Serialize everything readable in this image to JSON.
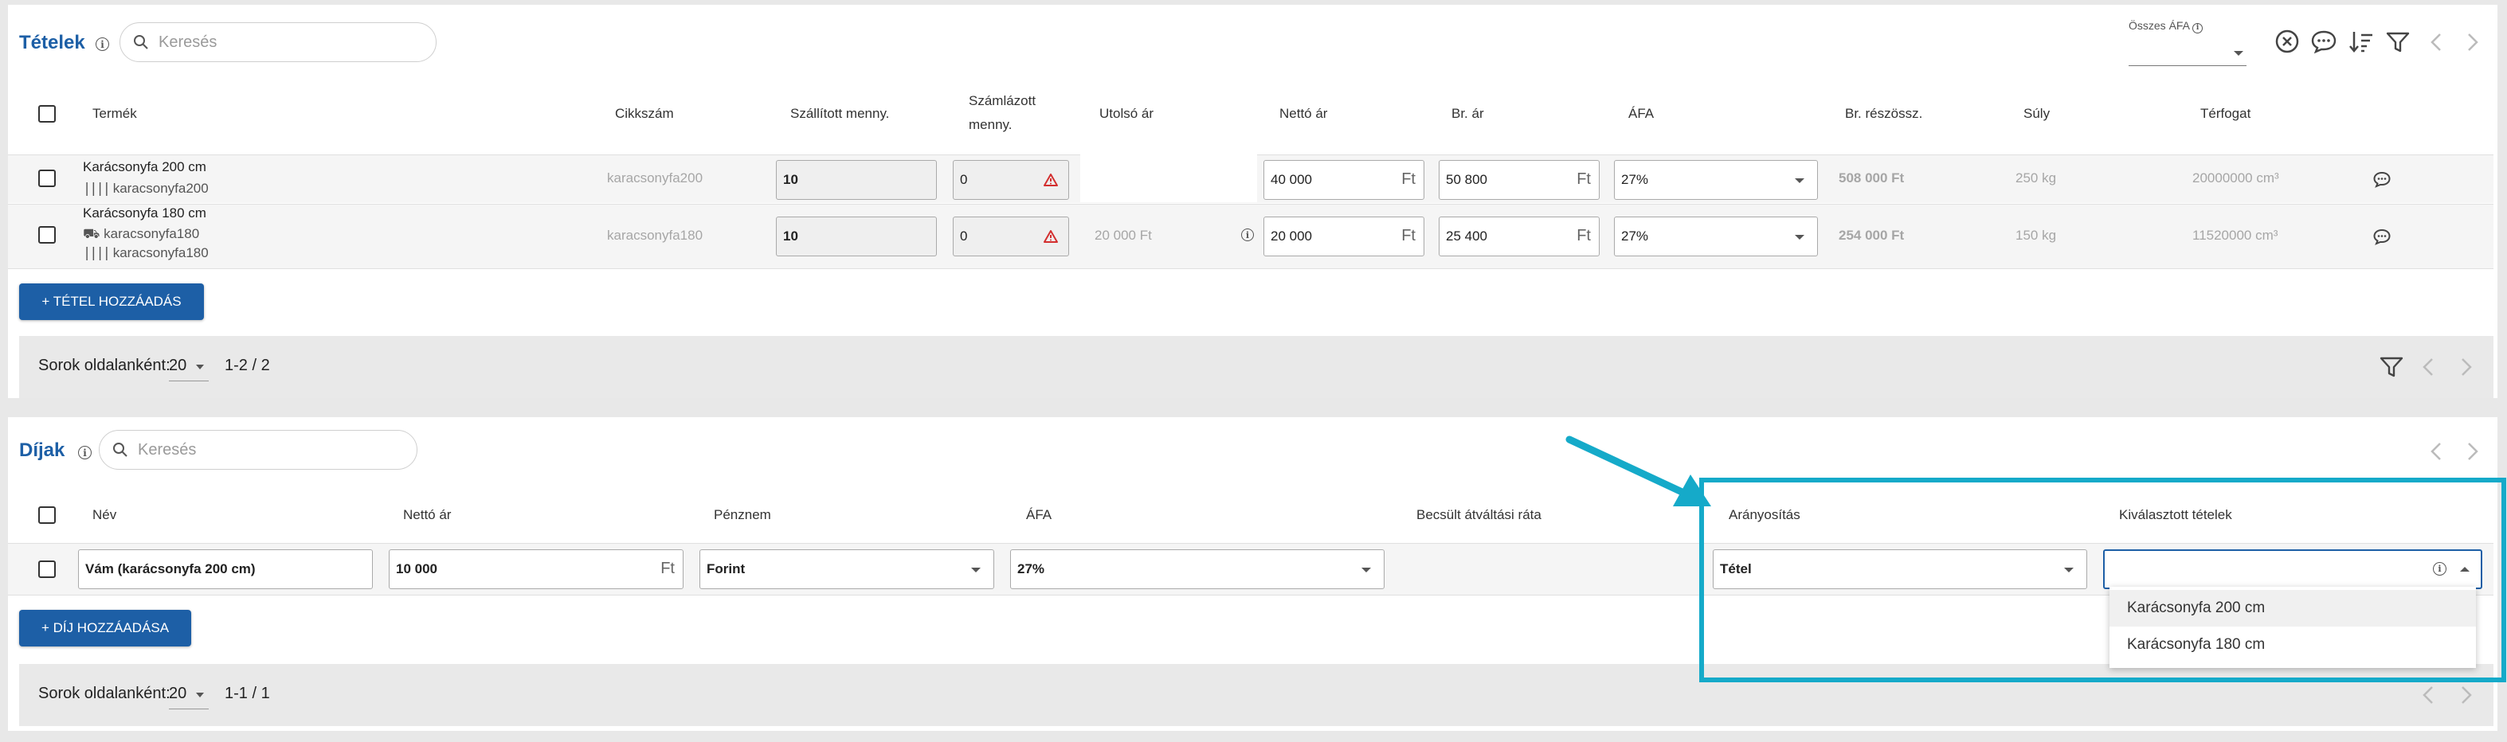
{
  "items_section": {
    "title": "Tételek",
    "search_placeholder": "Keresés",
    "total_vat_label": "Összes ÁFA",
    "columns": [
      "Termék",
      "Cikkszám",
      "Szállított menny.",
      "Számlázott",
      "menny.",
      "Utolsó ár",
      "Nettó ár",
      "Br. ár",
      "ÁFA",
      "Br. részössz.",
      "Súly",
      "Térfogat"
    ],
    "rows": [
      {
        "product": "Karácsonyfa 200 cm",
        "barcode": "karacsonyfa200",
        "sku": "karacsonyfa200",
        "delivered_qty": "10",
        "invoiced_qty": "0",
        "last_price": "",
        "net_price": "40 000",
        "gross_price": "50 800",
        "vat": "27%",
        "gross_subtotal": "508 000 Ft",
        "weight": "250 kg",
        "volume": "20000000 cm³"
      },
      {
        "product": "Karácsonyfa 180 cm",
        "supplier_code": "karacsonyfa180",
        "barcode": "karacsonyfa180",
        "sku": "karacsonyfa180",
        "delivered_qty": "10",
        "invoiced_qty": "0",
        "last_price": "20 000 Ft",
        "net_price": "20 000",
        "gross_price": "25 400",
        "vat": "27%",
        "gross_subtotal": "254 000 Ft",
        "weight": "150 kg",
        "volume": "11520000 cm³"
      }
    ],
    "currency_unit": "Ft",
    "add_button": "+ TÉTEL HOZZÁADÁS",
    "rows_per_page_label": "Sorok oldalanként:",
    "rows_per_page": "20",
    "range": "1-2 / 2"
  },
  "fees_section": {
    "title": "Díjak",
    "search_placeholder": "Keresés",
    "columns": [
      "Név",
      "Nettó ár",
      "Pénznem",
      "ÁFA",
      "Becsült átváltási ráta",
      "Arányosítás",
      "Kiválasztott tételek"
    ],
    "row": {
      "name": "Vám (karácsonyfa 200 cm)",
      "net_price": "10 000",
      "currency": "Forint",
      "vat": "27%",
      "proportioning": "Tétel",
      "selected_items": ""
    },
    "currency_unit": "Ft",
    "dropdown_options": [
      "Karácsonyfa 200 cm",
      "Karácsonyfa 180 cm"
    ],
    "add_button": "+ DÍJ HOZZÁADÁSA",
    "rows_per_page_label": "Sorok oldalanként:",
    "rows_per_page": "20",
    "range": "1-1 / 1"
  },
  "colors": {
    "accent": "#1d5fa6",
    "highlight": "#15aac9",
    "warning": "#d32f2f"
  }
}
